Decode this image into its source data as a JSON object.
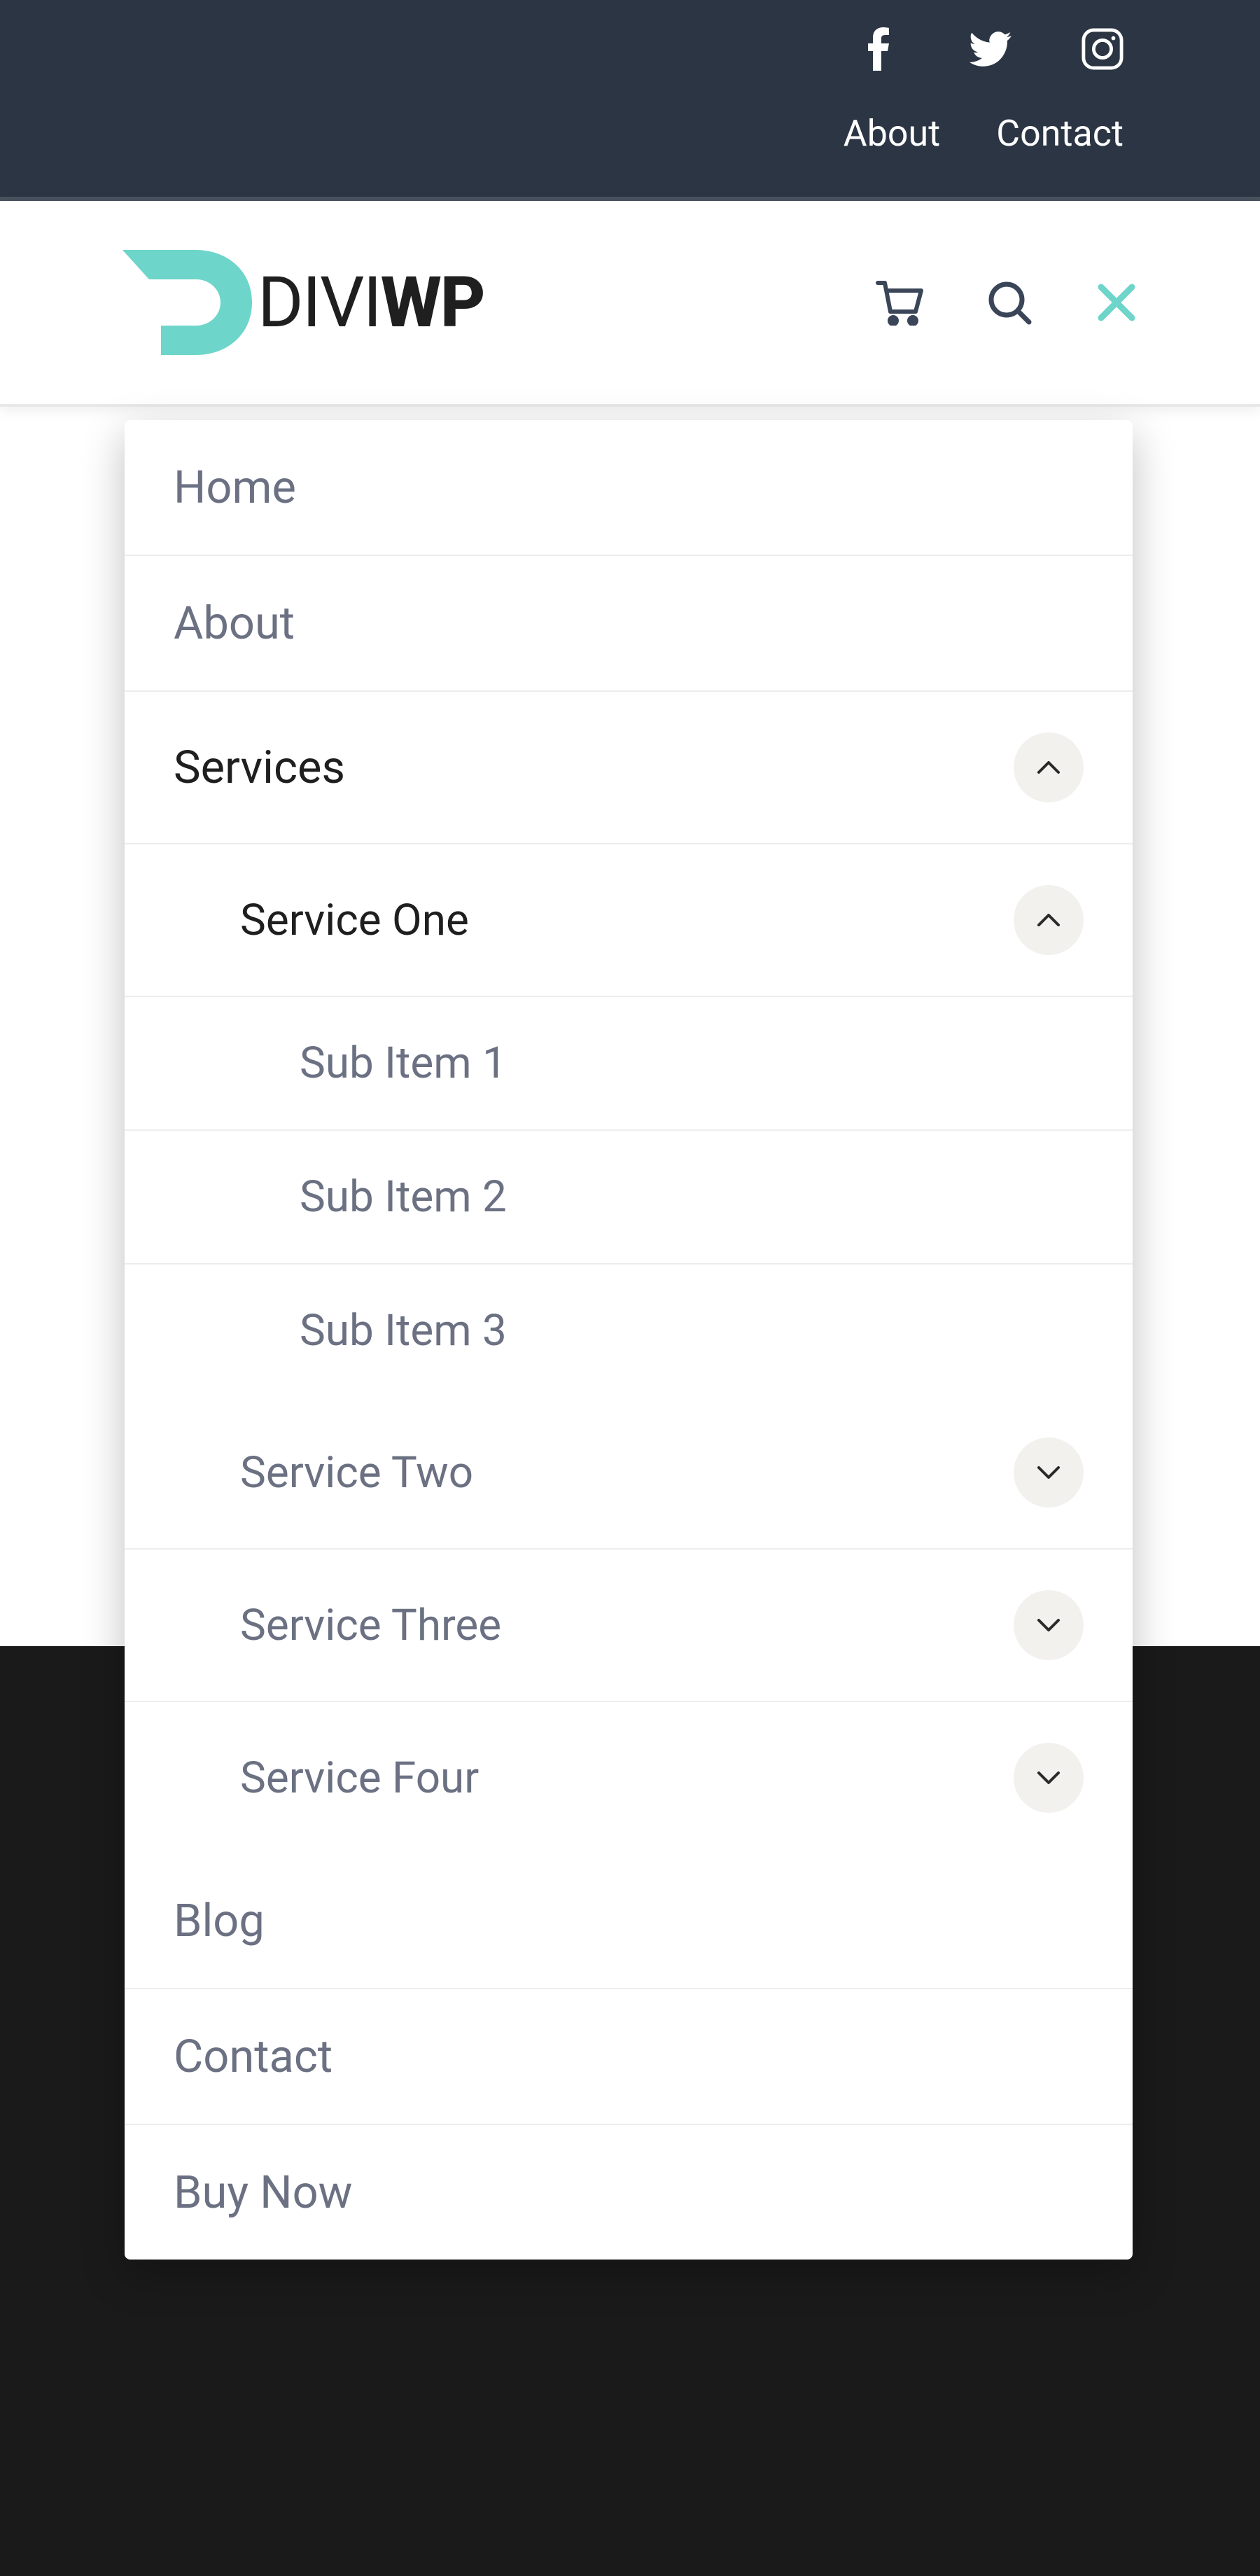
{
  "topBar": {
    "socialIcons": [
      "facebook",
      "twitter",
      "instagram"
    ],
    "links": [
      "About",
      "Contact"
    ]
  },
  "logo": {
    "textLight": "DIVI",
    "textBold": "WP"
  },
  "headerIcons": [
    "cart",
    "search",
    "close"
  ],
  "menu": {
    "items": [
      {
        "label": "Home",
        "active": false,
        "hasChildren": false
      },
      {
        "label": "About",
        "active": false,
        "hasChildren": false
      },
      {
        "label": "Services",
        "active": true,
        "hasChildren": true,
        "expanded": true,
        "children": [
          {
            "label": "Service One",
            "active": true,
            "hasChildren": true,
            "expanded": true,
            "children": [
              {
                "label": "Sub Item 1",
                "active": false,
                "hasChildren": false
              },
              {
                "label": "Sub Item 2",
                "active": false,
                "hasChildren": false
              },
              {
                "label": "Sub Item 3",
                "active": false,
                "hasChildren": false
              }
            ]
          },
          {
            "label": "Service Two",
            "active": false,
            "hasChildren": true,
            "expanded": false
          },
          {
            "label": "Service Three",
            "active": false,
            "hasChildren": true,
            "expanded": false
          },
          {
            "label": "Service Four",
            "active": false,
            "hasChildren": true,
            "expanded": false
          }
        ]
      },
      {
        "label": "Blog",
        "active": false,
        "hasChildren": false
      },
      {
        "label": "Contact",
        "active": false,
        "hasChildren": false
      },
      {
        "label": "Buy Now",
        "active": false,
        "hasChildren": false
      }
    ]
  },
  "colors": {
    "accent": "#6dd5c9",
    "darkBar": "#2b3543",
    "text": "#6b7182",
    "textActive": "#1f1f1f"
  }
}
